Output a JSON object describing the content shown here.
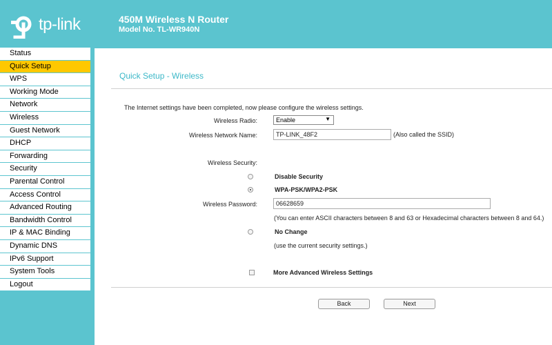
{
  "header": {
    "brand": "tp-link",
    "title": "450M Wireless N Router",
    "model": "Model No. TL-WR940N"
  },
  "sidebar": {
    "items": [
      {
        "label": "Status"
      },
      {
        "label": "Quick Setup",
        "active": true
      },
      {
        "label": "WPS"
      },
      {
        "label": "Working Mode"
      },
      {
        "label": "Network"
      },
      {
        "label": "Wireless"
      },
      {
        "label": "Guest Network"
      },
      {
        "label": "DHCP"
      },
      {
        "label": "Forwarding"
      },
      {
        "label": "Security"
      },
      {
        "label": "Parental Control"
      },
      {
        "label": "Access Control"
      },
      {
        "label": "Advanced Routing"
      },
      {
        "label": "Bandwidth Control"
      },
      {
        "label": "IP & MAC Binding"
      },
      {
        "label": "Dynamic DNS"
      },
      {
        "label": "IPv6 Support"
      },
      {
        "label": "System Tools"
      },
      {
        "label": "Logout"
      }
    ]
  },
  "main": {
    "title": "Quick Setup - Wireless",
    "intro": "The Internet settings have been completed, now please configure the wireless settings.",
    "wireless_radio_label": "Wireless Radio:",
    "wireless_radio_value": "Enable",
    "network_name_label": "Wireless Network Name:",
    "network_name_value": "TP-LINK_48F2",
    "network_name_hint": "(Also called the SSID)",
    "security_label": "Wireless Security:",
    "option_disable": "Disable Security",
    "option_wpa": "WPA-PSK/WPA2-PSK",
    "password_label": "Wireless Password:",
    "password_value": "06628659",
    "password_hint": "(You can enter ASCII characters between 8 and 63 or Hexadecimal characters between 8 and 64.)",
    "option_nochange": "No Change",
    "nochange_hint": "(use the current security settings.)",
    "advanced_label": "More Advanced Wireless Settings",
    "selected_security": "WPA-PSK/WPA2-PSK",
    "advanced_checked": false
  },
  "buttons": {
    "back": "Back",
    "next": "Next"
  },
  "colors": {
    "brand_teal": "#5bc4cf",
    "active_nav": "#ffc800",
    "title_text": "#3cb8c8"
  },
  "icons": {
    "logo": "tp-link-logo-icon",
    "select_arrow": "chevron-down-icon"
  }
}
